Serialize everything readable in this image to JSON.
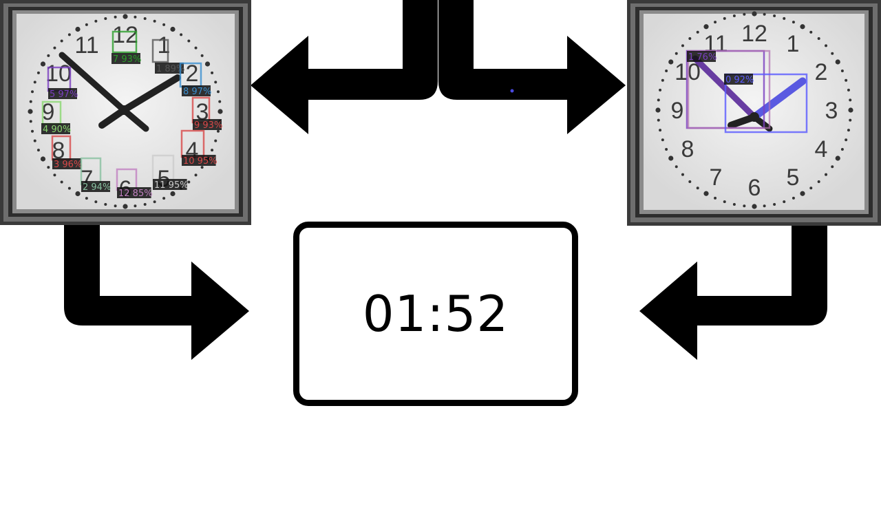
{
  "result": {
    "time": "01:52"
  },
  "left_clock": {
    "numerals": [
      "12",
      "1",
      "2",
      "3",
      "4",
      "5",
      "6",
      "7",
      "8",
      "9",
      "10",
      "11"
    ],
    "detections": [
      {
        "label": "7 93%",
        "color": "#2a9d2a"
      },
      {
        "label": "1 89%",
        "color": "#555555"
      },
      {
        "label": "8 97%",
        "color": "#3a8fd0"
      },
      {
        "label": "5 97%",
        "color": "#7a3fc0"
      },
      {
        "label": "9 93%",
        "color": "#d84848"
      },
      {
        "label": "4 90%",
        "color": "#8ad870"
      },
      {
        "label": "10 95%",
        "color": "#d84848"
      },
      {
        "label": "3 96%",
        "color": "#d84848"
      },
      {
        "label": "2 94%",
        "color": "#88c0a0"
      },
      {
        "label": "12 85%",
        "color": "#c080c0"
      },
      {
        "label": "11 95%",
        "color": "#cccccc"
      }
    ]
  },
  "right_clock": {
    "numerals": [
      "12",
      "1",
      "2",
      "3",
      "4",
      "5",
      "6",
      "7",
      "8",
      "9",
      "10",
      "11"
    ],
    "detections": [
      {
        "label": "1 76%",
        "color": "#7a3fc0"
      },
      {
        "label": "0 92%",
        "color": "#5a5aff"
      }
    ]
  },
  "colors": {
    "arrow": "#000000",
    "hand_highlight": "#4a4ae0",
    "background": "#ffffff"
  }
}
